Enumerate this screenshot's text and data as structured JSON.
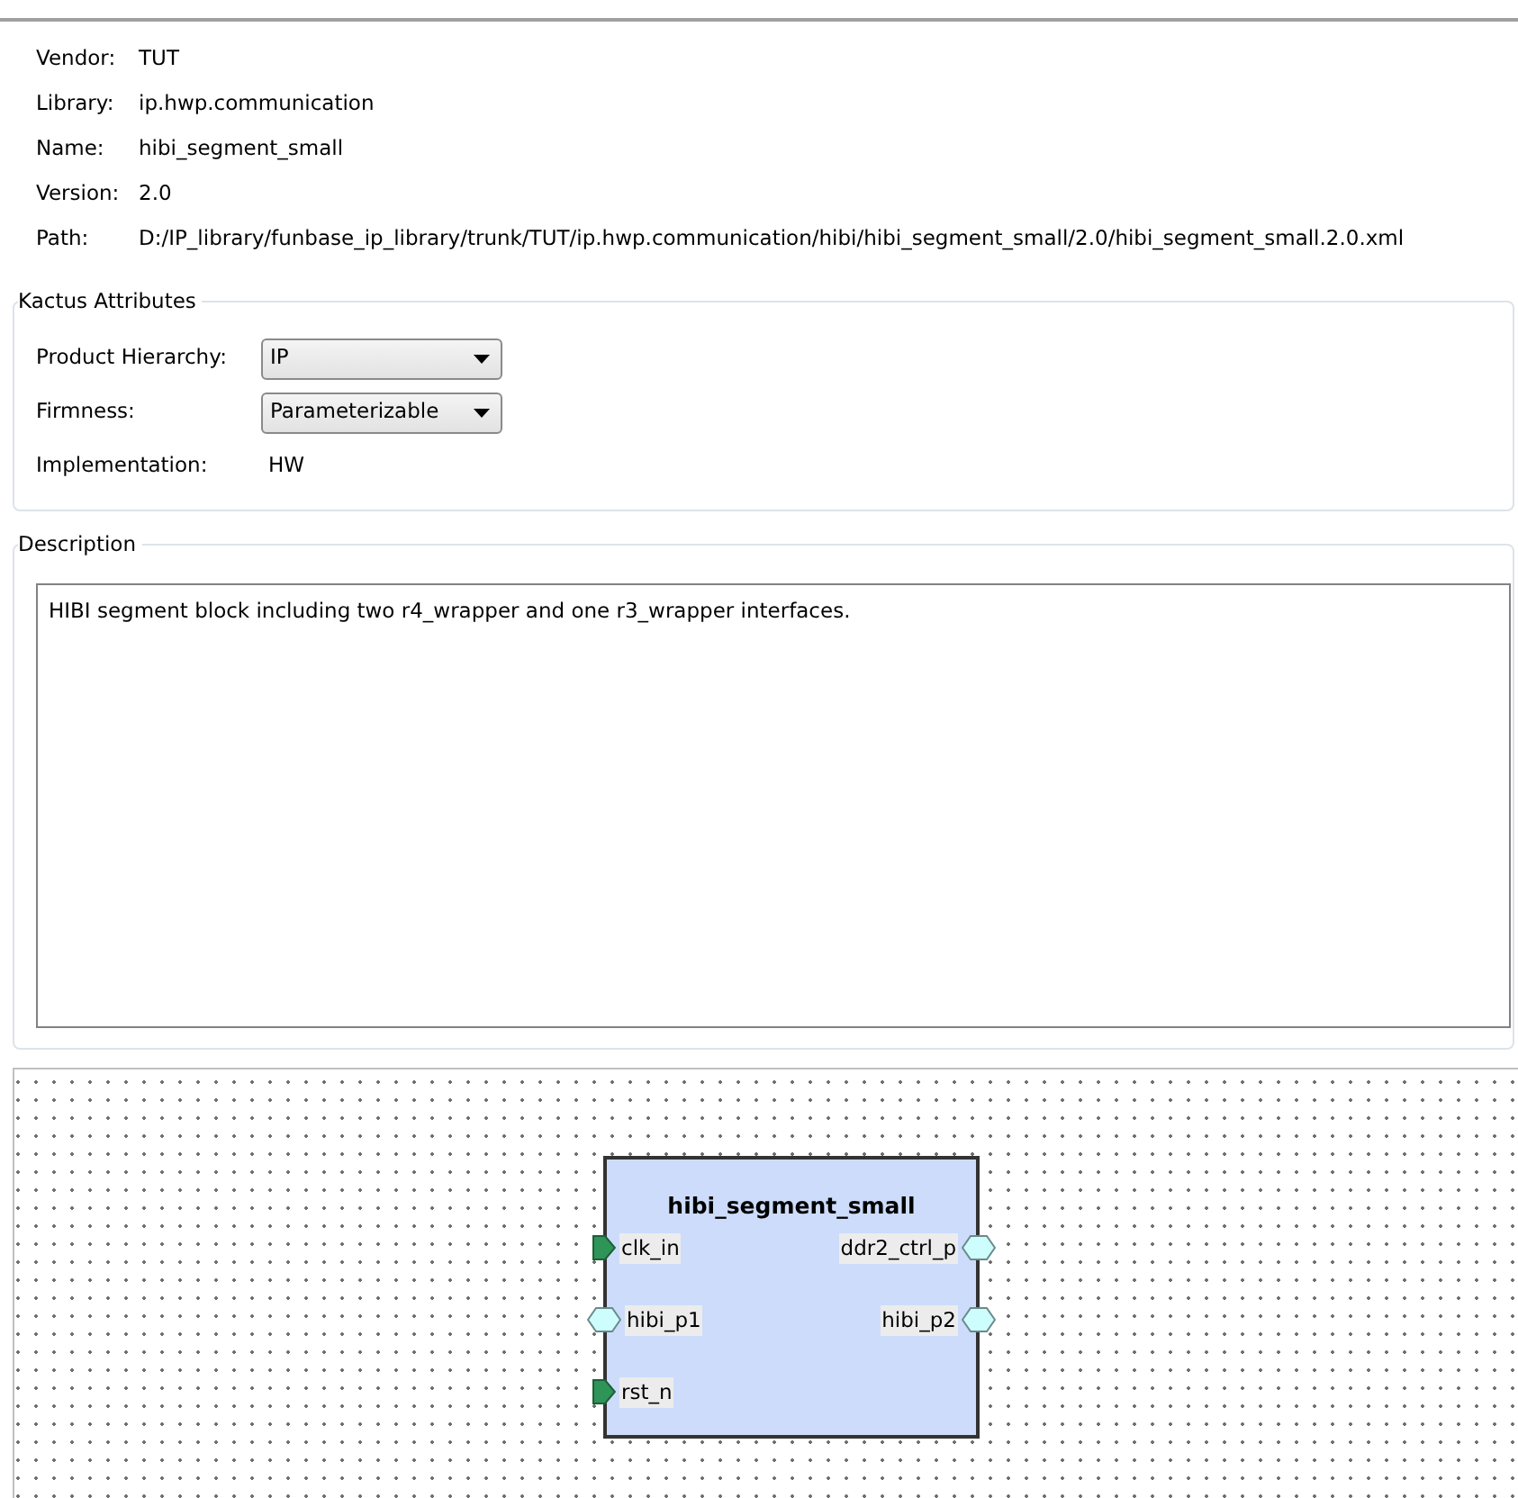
{
  "info": [
    {
      "label": "Vendor:",
      "value": "TUT"
    },
    {
      "label": "Library:",
      "value": "ip.hwp.communication"
    },
    {
      "label": "Name:",
      "value": "hibi_segment_small"
    },
    {
      "label": "Version:",
      "value": "2.0"
    },
    {
      "label": "Path:",
      "value": "D:/IP_library/funbase_ip_library/trunk/TUT/ip.hwp.communication/hibi/hibi_segment_small/2.0/hibi_segment_small.2.0.xml"
    }
  ],
  "kactus_attributes": {
    "title": "Kactus Attributes",
    "fields": [
      {
        "label": "Product Hierarchy:",
        "kind": "combo",
        "value": "IP"
      },
      {
        "label": "Firmness:",
        "kind": "combo",
        "value": "Parameterizable"
      },
      {
        "label": "Implementation:",
        "kind": "text",
        "value": "HW"
      }
    ]
  },
  "description": {
    "title": "Description",
    "text": "HIBI segment block including two r4_wrapper and one r3_wrapper interfaces."
  },
  "component": {
    "name": "hibi_segment_small",
    "left_ports": [
      {
        "name": "clk_in",
        "kind": "wire"
      },
      {
        "name": "hibi_p1",
        "kind": "bus"
      },
      {
        "name": "rst_n",
        "kind": "wire"
      }
    ],
    "right_ports": [
      {
        "name": "ddr2_ctrl_p",
        "kind": "bus"
      },
      {
        "name": "hibi_p2",
        "kind": "bus"
      }
    ]
  }
}
